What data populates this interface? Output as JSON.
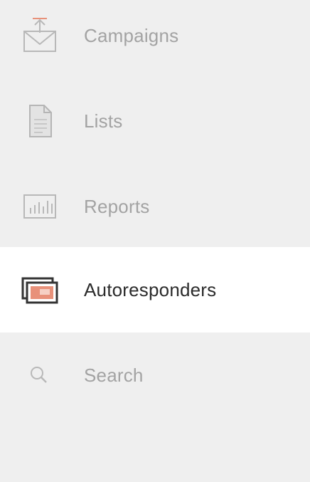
{
  "sidebar": {
    "items": [
      {
        "label": "Campaigns",
        "icon": "envelope-upload-icon",
        "active": false
      },
      {
        "label": "Lists",
        "icon": "document-icon",
        "active": false
      },
      {
        "label": "Reports",
        "icon": "bar-chart-icon",
        "active": false
      },
      {
        "label": "Autoresponders",
        "icon": "stacked-cards-icon",
        "active": true
      },
      {
        "label": "Search",
        "icon": "search-icon",
        "active": false
      }
    ]
  },
  "colors": {
    "background": "#efefef",
    "active_background": "#ffffff",
    "inactive_text": "#a3a3a3",
    "active_text": "#2b2b2b",
    "icon_stroke": "#b8b8b8",
    "accent": "#e8917a"
  }
}
